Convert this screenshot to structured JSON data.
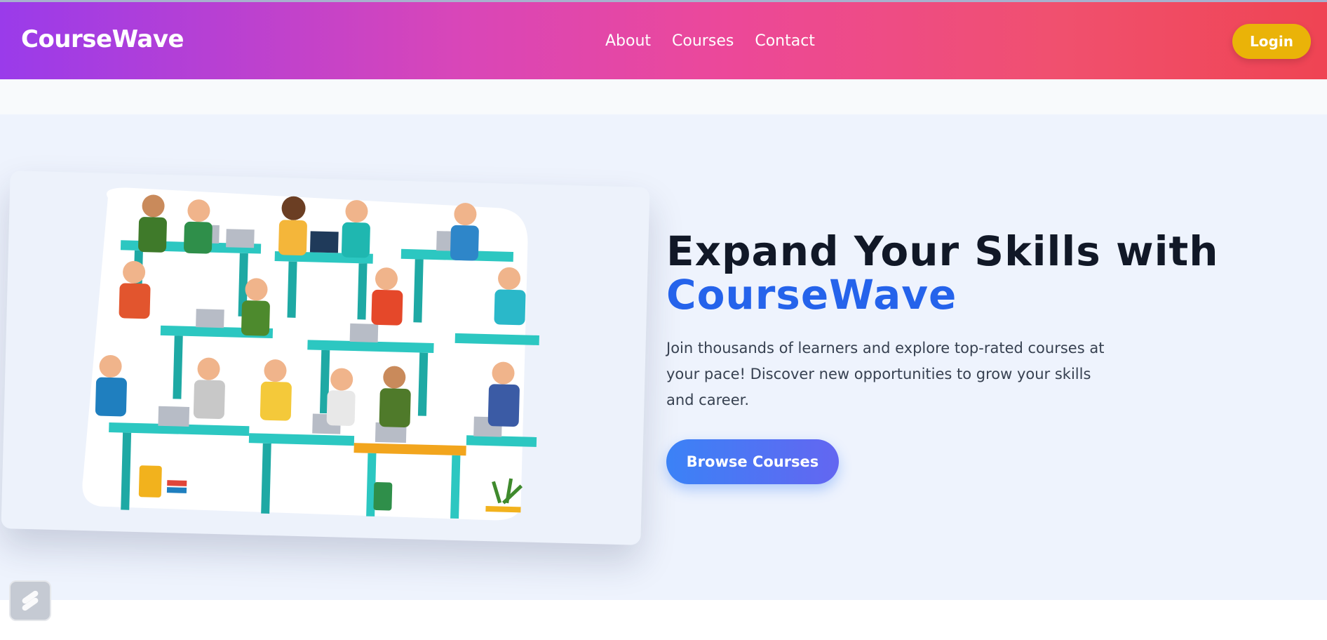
{
  "header": {
    "brand": "CourseWave",
    "nav": [
      {
        "label": "About"
      },
      {
        "label": "Courses"
      },
      {
        "label": "Contact"
      }
    ],
    "login_label": "Login"
  },
  "hero": {
    "title_line1": "Expand Your Skills with",
    "title_accent": "CourseWave",
    "description": "Join thousands of learners and explore top-rated courses at your pace! Discover new opportunities to grow your skills and career.",
    "cta_label": "Browse Courses",
    "image_subject": "students-studying-illustration"
  },
  "widget": {
    "icon": "lightning-widget-icon"
  },
  "colors": {
    "navbar_gradient": [
      "#9a3bea",
      "#ec4899",
      "#ef4453"
    ],
    "login_button": "#eab308",
    "accent_text": "#2563eb",
    "cta_gradient": [
      "#3b82f6",
      "#6366f1"
    ]
  }
}
